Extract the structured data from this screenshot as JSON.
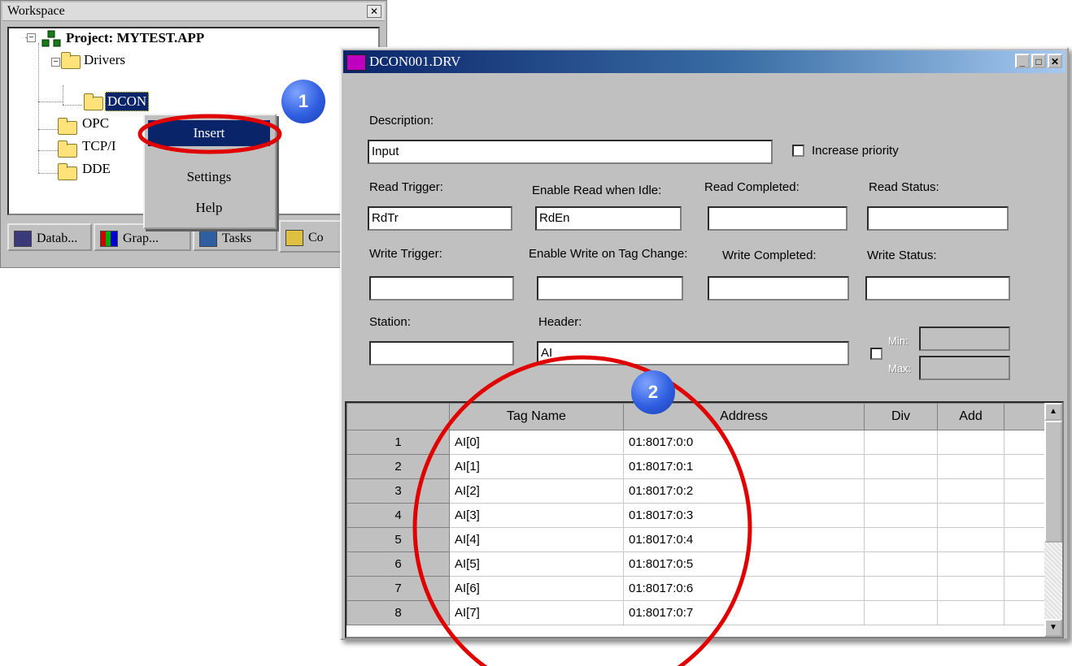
{
  "workspace": {
    "title": "Workspace",
    "close_glyph": "✕",
    "tree": {
      "project": "Project: MYTEST.APP",
      "drivers": "Drivers",
      "dcon": "DCON",
      "opc": "OPC",
      "tcp": "TCP/I",
      "dde": "DDE"
    },
    "tabs": [
      "Datab...",
      "Grap...",
      "Tasks",
      "Co"
    ]
  },
  "context_menu": {
    "items": [
      "Insert",
      "Settings",
      "Help"
    ]
  },
  "driver": {
    "title": "DCON001.DRV",
    "labels": {
      "description": "Description:",
      "increase_priority": "Increase priority",
      "read_trigger": "Read Trigger:",
      "enable_read": "Enable Read when Idle:",
      "read_completed": "Read Completed:",
      "read_status": "Read Status:",
      "write_trigger": "Write Trigger:",
      "enable_write": "Enable Write on Tag Change:",
      "write_completed": "Write Completed:",
      "write_status": "Write Status:",
      "station": "Station:",
      "header": "Header:",
      "min": "Min:",
      "max": "Max:"
    },
    "values": {
      "description": "Input",
      "read_trigger": "RdTr",
      "enable_read": "RdEn",
      "read_completed": "",
      "read_status": "",
      "write_trigger": "",
      "enable_write": "",
      "write_completed": "",
      "write_status": "",
      "station": "",
      "header": "AI",
      "min": "",
      "max": ""
    },
    "grid": {
      "columns": [
        "",
        "Tag Name",
        "Address",
        "Div",
        "Add"
      ],
      "rows": [
        {
          "n": "1",
          "tag": "AI[0]",
          "address": "01:8017:0:0"
        },
        {
          "n": "2",
          "tag": "AI[1]",
          "address": "01:8017:0:1"
        },
        {
          "n": "3",
          "tag": "AI[2]",
          "address": "01:8017:0:2"
        },
        {
          "n": "4",
          "tag": "AI[3]",
          "address": "01:8017:0:3"
        },
        {
          "n": "5",
          "tag": "AI[4]",
          "address": "01:8017:0:4"
        },
        {
          "n": "6",
          "tag": "AI[5]",
          "address": "01:8017:0:5"
        },
        {
          "n": "7",
          "tag": "AI[6]",
          "address": "01:8017:0:6"
        },
        {
          "n": "8",
          "tag": "AI[7]",
          "address": "01:8017:0:7"
        }
      ]
    }
  },
  "callouts": [
    "1",
    "2"
  ],
  "colors": {
    "title_active": "#0a246a",
    "menu_highlight": "#0a246a",
    "callout_ring": "#e00000",
    "callout_badge": "#2f5ee0"
  }
}
